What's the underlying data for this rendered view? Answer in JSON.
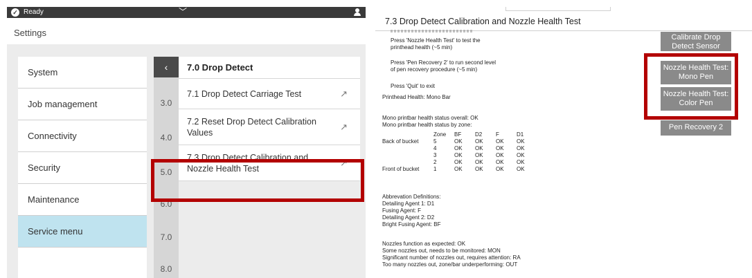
{
  "status_bar": {
    "status": "Ready",
    "check_icon": "check-circle-icon",
    "chevron_icon": "chevron-down-icon",
    "user_icon": "user-icon"
  },
  "settings_title": "Settings",
  "sidebar": {
    "items": [
      {
        "label": "System"
      },
      {
        "label": "Job management"
      },
      {
        "label": "Connectivity"
      },
      {
        "label": "Security"
      },
      {
        "label": "Maintenance"
      },
      {
        "label": "Service menu",
        "active": true
      },
      {
        "label": ""
      }
    ]
  },
  "section_numbers": [
    "3.0",
    "4.0",
    "5.0",
    "6.0",
    "7.0",
    "8.0"
  ],
  "menu": {
    "back": "‹",
    "title": "7.0 Drop Detect",
    "items": [
      {
        "label": "7.1 Drop Detect Carriage Test"
      },
      {
        "label": "7.2 Reset Drop Detect Calibration Values"
      },
      {
        "label": "7.3 Drop Detect Calibration and Nozzle Health Test",
        "highlighted": true
      }
    ]
  },
  "detail": {
    "title": "7.3 Drop Detect Calibration and Nozzle Health Test",
    "instructions": [
      "Press 'Nozzle Health Test' to test the",
      "printhead health (~5 min)",
      "Press 'Pen Recovery 2' to run second level",
      "of pen recovery procedure (~5 min)",
      "Press 'Quit' to exit"
    ],
    "printhead_health": "Printhead Health: Mono Bar",
    "overall_status": "Mono printbar health status overall: OK",
    "zone_status": "Mono printbar health status by zone:",
    "zone_table": {
      "headers": [
        "Zone",
        "BF",
        "D2",
        "F",
        "D1"
      ],
      "rows": [
        {
          "label": "Back of bucket",
          "zone": "5",
          "values": [
            "OK",
            "OK",
            "OK",
            "OK"
          ]
        },
        {
          "label": "",
          "zone": "4",
          "values": [
            "OK",
            "OK",
            "OK",
            "OK"
          ]
        },
        {
          "label": "",
          "zone": "3",
          "values": [
            "OK",
            "OK",
            "OK",
            "OK"
          ]
        },
        {
          "label": "",
          "zone": "2",
          "values": [
            "OK",
            "OK",
            "OK",
            "OK"
          ]
        },
        {
          "label": "Front of bucket",
          "zone": "1",
          "values": [
            "OK",
            "OK",
            "OK",
            "OK"
          ]
        }
      ]
    },
    "abbreviations": [
      "Abbrevation Definitions:",
      "Detailing Agent 1: D1",
      "Fusing Agent: F",
      "Detailing Agent 2: D2",
      "Bright Fusing Agent: BF"
    ],
    "legend": [
      "Nozzles function as expected: OK",
      "Some nozzles out, needs to be monitored: MON",
      "Significant number of nozzles out, requires attention: RA",
      "Too many nozzles out, zone/bar underperforming: OUT"
    ],
    "buttons": [
      {
        "label": "Calibrate Drop Detect Sensor"
      },
      {
        "label": "Nozzle Health Test: Mono Pen",
        "highlighted": true
      },
      {
        "label": "Nozzle Health Test: Color Pen",
        "highlighted": true
      },
      {
        "label": "Pen Recovery 2"
      }
    ]
  },
  "colors": {
    "highlight": "#b30000",
    "active_nav": "#bfe3ef",
    "button_gray": "#8a8a8a",
    "top_bar": "#3a3a3a"
  }
}
